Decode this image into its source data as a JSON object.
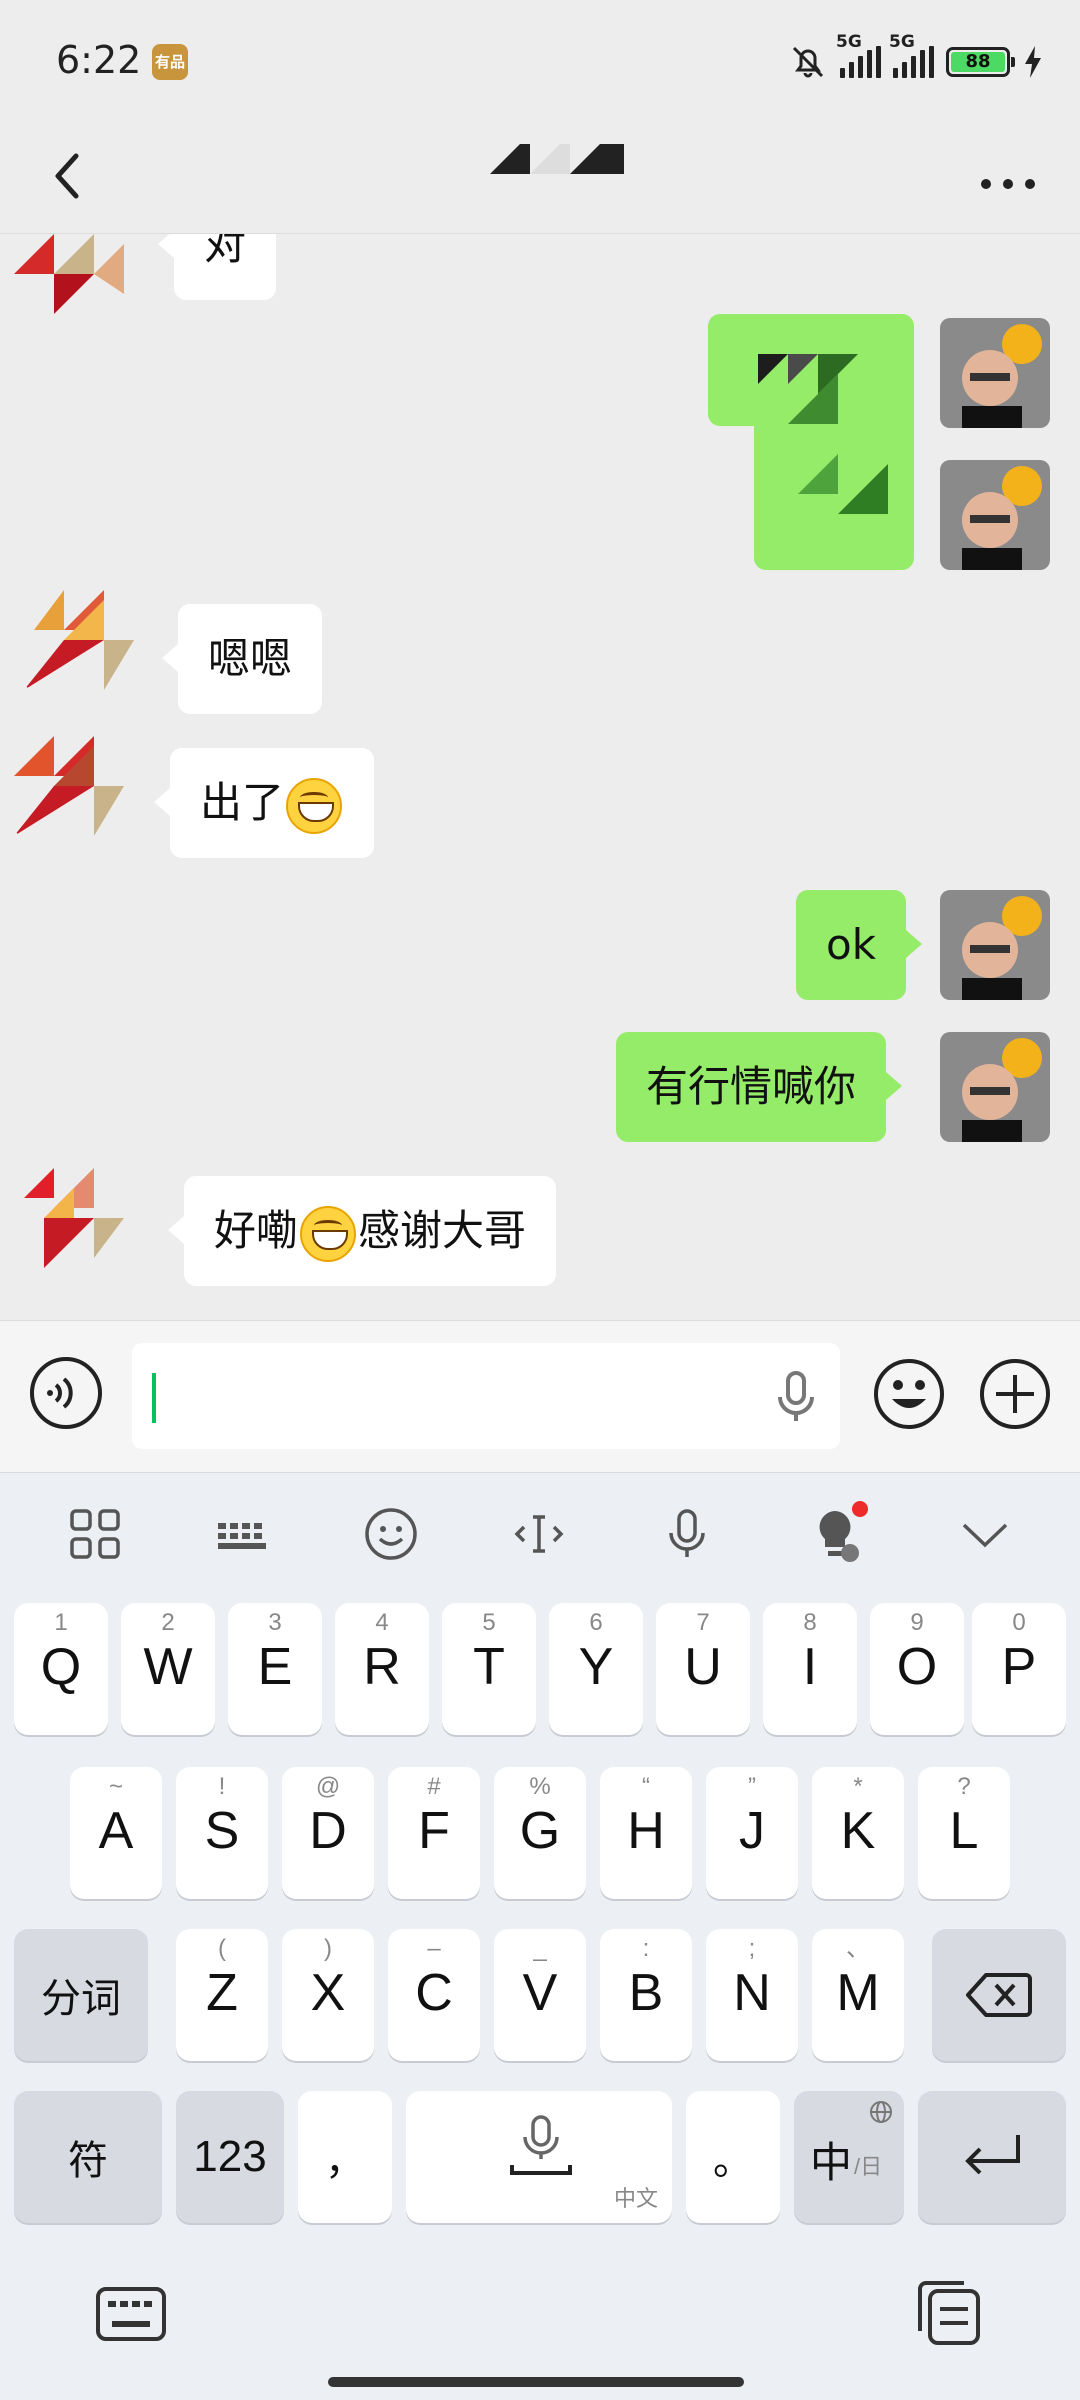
{
  "status_bar": {
    "time": "6:22",
    "app_badge": "有品",
    "signal1_label": "5G",
    "signal2_label": "5G",
    "battery": "88",
    "battery_color": "#4cd964"
  },
  "nav": {
    "back_icon": "chevron-left-icon",
    "more_icon": "more-dots-icon"
  },
  "messages": {
    "m0": "对",
    "m3": "嗯嗯",
    "m4": "出了",
    "m5": "ok",
    "m6": "有行情喊你",
    "m7_a": "好嘞",
    "m7_b": "感谢大哥"
  },
  "input": {
    "placeholder": "",
    "voice_icon": "voice-icon",
    "mic_icon": "microphone-icon",
    "emoji_icon": "emoji-icon",
    "plus_icon": "plus-icon"
  },
  "keyboard": {
    "row1": [
      {
        "main": "Q",
        "sub": "1"
      },
      {
        "main": "W",
        "sub": "2"
      },
      {
        "main": "E",
        "sub": "3"
      },
      {
        "main": "R",
        "sub": "4"
      },
      {
        "main": "T",
        "sub": "5"
      },
      {
        "main": "Y",
        "sub": "6"
      },
      {
        "main": "U",
        "sub": "7"
      },
      {
        "main": "I",
        "sub": "8"
      },
      {
        "main": "O",
        "sub": "9"
      },
      {
        "main": "P",
        "sub": "0"
      }
    ],
    "row2": [
      {
        "main": "A",
        "sub": "~"
      },
      {
        "main": "S",
        "sub": "!"
      },
      {
        "main": "D",
        "sub": "@"
      },
      {
        "main": "F",
        "sub": "#"
      },
      {
        "main": "G",
        "sub": "%"
      },
      {
        "main": "H",
        "sub": "“"
      },
      {
        "main": "J",
        "sub": "”"
      },
      {
        "main": "K",
        "sub": "*"
      },
      {
        "main": "L",
        "sub": "?"
      }
    ],
    "row3": [
      {
        "main": "Z",
        "sub": "("
      },
      {
        "main": "X",
        "sub": ")"
      },
      {
        "main": "C",
        "sub": "–"
      },
      {
        "main": "V",
        "sub": "_"
      },
      {
        "main": "B",
        "sub": ":"
      },
      {
        "main": "N",
        "sub": ";"
      },
      {
        "main": "M",
        "sub": "、"
      }
    ],
    "fenci": "分词",
    "fu": "符",
    "num": "123",
    "comma": "，",
    "space_sub": "中文",
    "period": "。",
    "lang_main": "中",
    "lang_sub": "/日"
  }
}
